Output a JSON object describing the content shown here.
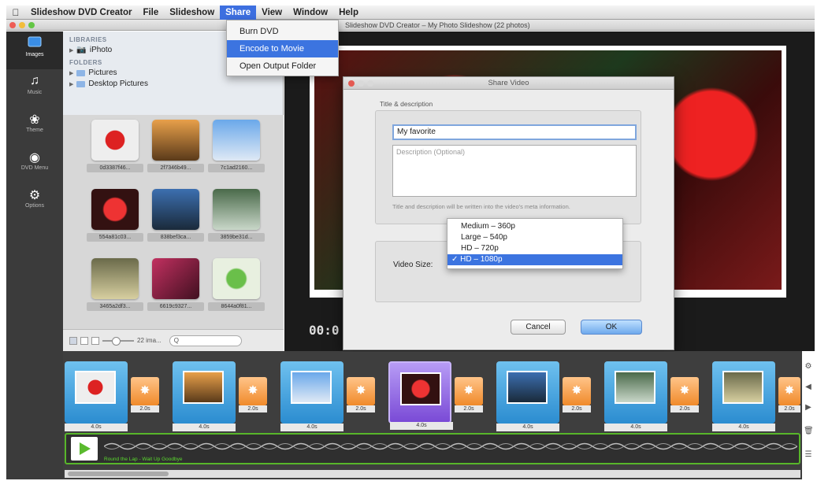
{
  "menubar": {
    "apple": "",
    "items": [
      "Slideshow DVD Creator",
      "File",
      "Slideshow",
      "Share",
      "View",
      "Window",
      "Help"
    ],
    "active": "Share"
  },
  "window": {
    "title": "Slideshow DVD Creator – My Photo Slideshow (22 photos)"
  },
  "share_menu": {
    "items": [
      "Burn DVD",
      "Encode to Movie",
      "Open Output Folder"
    ],
    "highlighted": "Encode to Movie"
  },
  "sidebar": {
    "items": [
      {
        "label": "Images",
        "icon": "images-icon"
      },
      {
        "label": "Music",
        "icon": "music-icon"
      },
      {
        "label": "Theme",
        "icon": "theme-icon"
      },
      {
        "label": "DVD Menu",
        "icon": "dvd-menu-icon"
      },
      {
        "label": "Options",
        "icon": "gear-icon"
      }
    ]
  },
  "library": {
    "libraries_header": "LIBRARIES",
    "iphoto": "iPhoto",
    "folders_header": "FOLDERS",
    "folders": [
      "Pictures",
      "Desktop Pictures"
    ]
  },
  "thumbnails": {
    "captions": [
      "0d3387f46...",
      "2f7346b49...",
      "7c1ad2160...",
      "554a81c03...",
      "838bef3ca...",
      "3859be31d...",
      "3465a2df3...",
      "6619c9327...",
      "8644a0f81..."
    ]
  },
  "gridbar": {
    "count": "22 ima...",
    "search_placeholder": "Q"
  },
  "preview": {
    "time": "00:0"
  },
  "dialog": {
    "title": "Share Video",
    "section_label": "Title & description",
    "title_value": "My favorite",
    "description_placeholder": "Description (Optional)",
    "hint": "Title and description will be written into the video's meta information.",
    "video_size_label": "Video Size:",
    "cancel": "Cancel",
    "ok": "OK"
  },
  "size_options": {
    "items": [
      "Medium – 360p",
      "Large – 540p",
      "HD – 720p",
      "✓ HD – 1080p"
    ],
    "selected_index": 3
  },
  "timeline": {
    "clip_duration": "4.0s",
    "transition_duration": "2.0s",
    "song": "Round the Lap - Wait Up Goodbye"
  },
  "colors": {
    "accent": "#3c74e0",
    "clip_blue": "#2b8cd0",
    "clip_selected": "#7a4ad6",
    "transition_orange": "#f08a2a",
    "audio_green": "#58b62a"
  }
}
